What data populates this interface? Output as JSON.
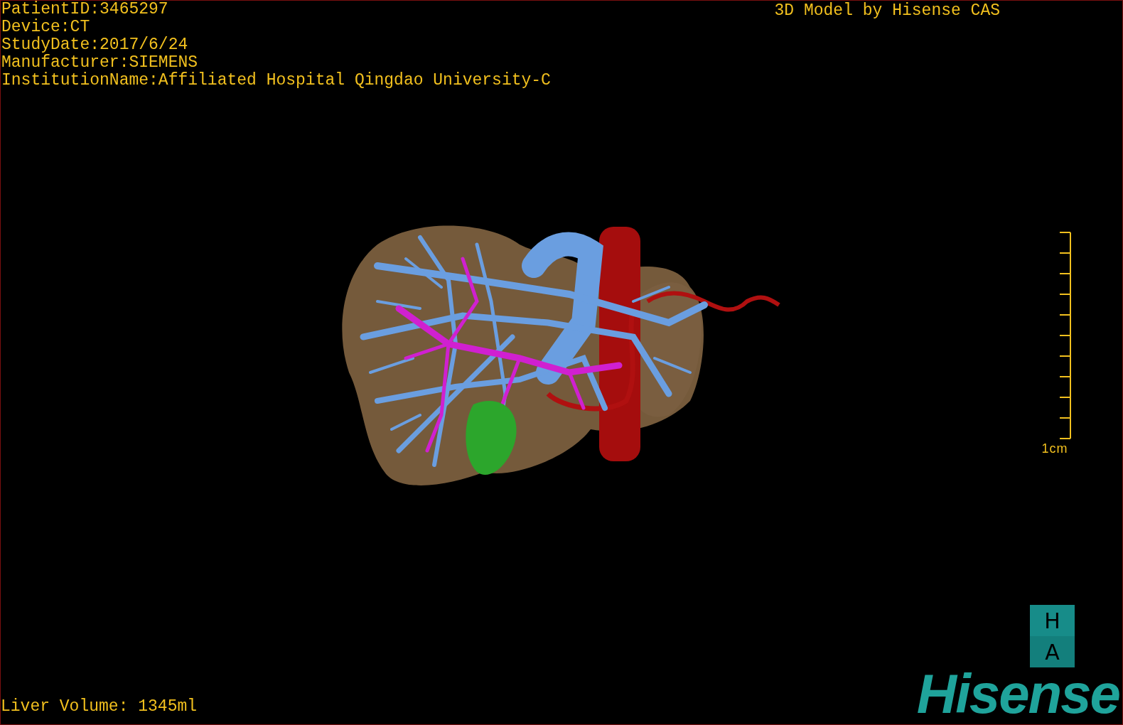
{
  "study_info": [
    "PatientID:3465297",
    "Device:CT",
    "StudyDate:2017/6/24",
    "Manufacturer:SIEMENS",
    "InstitutionName:Affiliated Hospital Qingdao University-C"
  ],
  "title": "3D Model by Hisense CAS",
  "scale_bar": {
    "label": "1cm"
  },
  "orientation_marker": [
    "H",
    "A"
  ],
  "liver_volume": "Liver Volume: 1345ml",
  "logo": "Hisense"
}
